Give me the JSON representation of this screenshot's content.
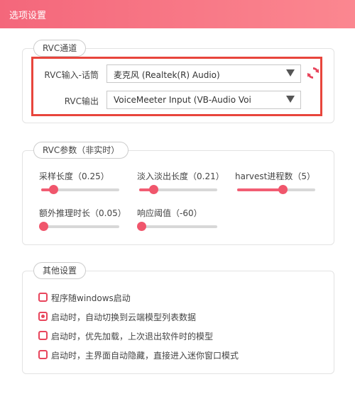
{
  "window": {
    "title": "选项设置"
  },
  "rvc_channel": {
    "label": "RVC通道",
    "input_label": "RVC输入-话筒",
    "input_value": "麦克风 (Realtek(R) Audio)",
    "output_label": "RVC输出",
    "output_value": "VoiceMeeter Input (VB-Audio Voi",
    "highlight_color": "#e8453c"
  },
  "rvc_params": {
    "label": "RVC参数（非实时）",
    "sliders": [
      {
        "label": "采样长度（0.25）",
        "fraction": 0.15
      },
      {
        "label": "淡入淡出长度（0.21）",
        "fraction": 0.18
      },
      {
        "label": "harvest进程数（5）",
        "fraction": 0.58
      },
      {
        "label": "额外推理时长（0.05）",
        "fraction": 0.0
      },
      {
        "label": "响应阈值（-60）",
        "fraction": 0.0
      }
    ]
  },
  "other_settings": {
    "label": "其他设置",
    "options": [
      {
        "label": "程序随windows启动",
        "checked": false
      },
      {
        "label": "启动时，自动切换到云端模型列表数据",
        "checked": true
      },
      {
        "label": "启动时，优先加载，上次退出软件时的模型",
        "checked": false
      },
      {
        "label": "启动时，主界面自动隐藏，直接进入迷你窗口模式",
        "checked": false
      }
    ]
  },
  "colors": {
    "accent": "#f25d73",
    "titlebar_start": "#f4677b",
    "titlebar_end": "#fb8790"
  },
  "icons": {
    "refresh": "refresh-icon",
    "dropdown": "chevron-down-icon"
  }
}
